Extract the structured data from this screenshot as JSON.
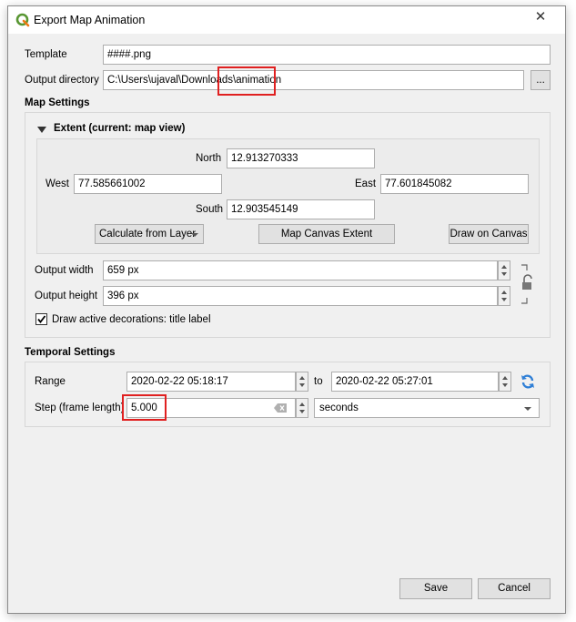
{
  "window": {
    "title": "Export Map Animation",
    "close_glyph": "✕",
    "icon": "qgis-logo-icon"
  },
  "template": {
    "label": "Template",
    "value": "####.png"
  },
  "output_directory": {
    "label": "Output directory",
    "value": "C:\\Users\\ujaval\\Downloads\\animation",
    "browse_label": "..."
  },
  "map_settings": {
    "title": "Map Settings",
    "extent": {
      "title": "Extent (current: map view)",
      "north_label": "North",
      "north": "12.913270333",
      "west_label": "West",
      "west": "77.585661002",
      "east_label": "East",
      "east": "77.601845082",
      "south_label": "South",
      "south": "12.903545149",
      "calc_layer_label": "Calculate from Layer",
      "map_canvas_label": "Map Canvas Extent",
      "draw_canvas_label": "Draw on Canvas"
    },
    "output_width_label": "Output width",
    "output_width": "659 px",
    "output_height_label": "Output height",
    "output_height": "396 px",
    "draw_decorations_label": "Draw active decorations: title label",
    "draw_decorations_checked": true
  },
  "temporal_settings": {
    "title": "Temporal Settings",
    "range_label": "Range",
    "range_start": "2020-02-22 05:18:17",
    "to_label": "to",
    "range_end": "2020-02-22 05:27:01",
    "step_label": "Step (frame length)",
    "step_value": "5.000",
    "step_unit": "seconds"
  },
  "buttons": {
    "save": "Save",
    "cancel": "Cancel"
  },
  "colors": {
    "highlight": "#e02020",
    "qgis_green": "#589632",
    "refresh_blue": "#2f7fd6"
  }
}
